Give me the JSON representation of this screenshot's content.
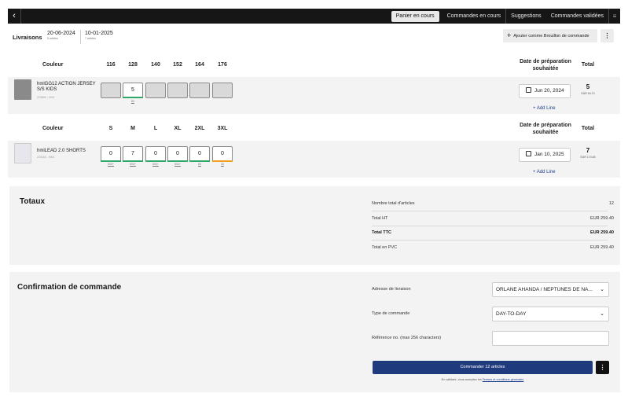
{
  "topbar": {
    "back_icon": "chevron-left-icon",
    "tabs": [
      {
        "label": "Panier en cours",
        "active": true
      },
      {
        "label": "Commandes en cours",
        "active": false
      },
      {
        "label": "Suggestions",
        "active": false
      },
      {
        "label": "Commandes validées",
        "active": false
      }
    ],
    "list_icon": "list-icon"
  },
  "deliveries": {
    "title": "Livraisons",
    "dates": [
      {
        "date": "20-06-2024",
        "sub": "5 articles"
      },
      {
        "date": "10-01-2025",
        "sub": "7 articles"
      }
    ],
    "draft_button": "Ajouter comme Brouillon de commande"
  },
  "products": [
    {
      "header": {
        "color": "Couleur",
        "sizes": [
          "116",
          "128",
          "140",
          "152",
          "164",
          "176"
        ],
        "date": "Date de préparation souhaitée",
        "total": "Total"
      },
      "name": "hmlGG12 ACTION JERSEY S/S KIDS",
      "sku": "213890 - 1100",
      "quantities": [
        "",
        "5",
        "",
        "",
        "",
        ""
      ],
      "stock": [
        "",
        "80",
        "",
        "",
        "",
        ""
      ],
      "date": "Jun 20, 2024",
      "add_line": "+ Add Line",
      "total_qty": "5",
      "total_eur": "EUR 94.70"
    },
    {
      "header": {
        "color": "Couleur",
        "sizes": [
          "S",
          "M",
          "L",
          "XL",
          "2XL",
          "3XL"
        ],
        "date": "Date de préparation souhaitée",
        "total": "Total"
      },
      "name": "hmlLEAD 2.0 SHORTS",
      "sku": "223163 - 9001",
      "quantities": [
        "0",
        "7",
        "0",
        "0",
        "0",
        "0"
      ],
      "stock": [
        "500+",
        "500+",
        "500+",
        "500+",
        "80",
        "40"
      ],
      "date": "Jan 10, 2025",
      "add_line": "+ Add Line",
      "total_qty": "7",
      "total_eur": "EUR 174.65"
    }
  ],
  "totals": {
    "title": "Totaux",
    "rows": [
      {
        "label": "Nombre total d'articles",
        "value": "12",
        "bold": false
      },
      {
        "label": "Total HT",
        "value": "EUR 259.40",
        "bold": false
      },
      {
        "label": "Total TTC",
        "value": "EUR 259.40",
        "bold": true
      },
      {
        "label": "Total en PVC",
        "value": "EUR 259.40",
        "bold": false
      }
    ]
  },
  "confirmation": {
    "title": "Confirmation de commande",
    "address_label": "Adresse de livraison",
    "address_value": "ORLANE AHANDA / NEPTUNES DE NA...",
    "type_label": "Type de commande",
    "type_value": "DAY-TO-DAY",
    "ref_label": "Référence no. (max 256 characters)",
    "ref_value": "",
    "order_button": "Commander 12 articles",
    "legal_prefix": "En validant, vous acceptez les",
    "legal_link": "Termes et conditions générales"
  },
  "colors": {
    "accent": "#1f3a7d",
    "stock_green": "#2fa86a",
    "stock_orange": "#f0a020",
    "topbar": "#161616"
  }
}
